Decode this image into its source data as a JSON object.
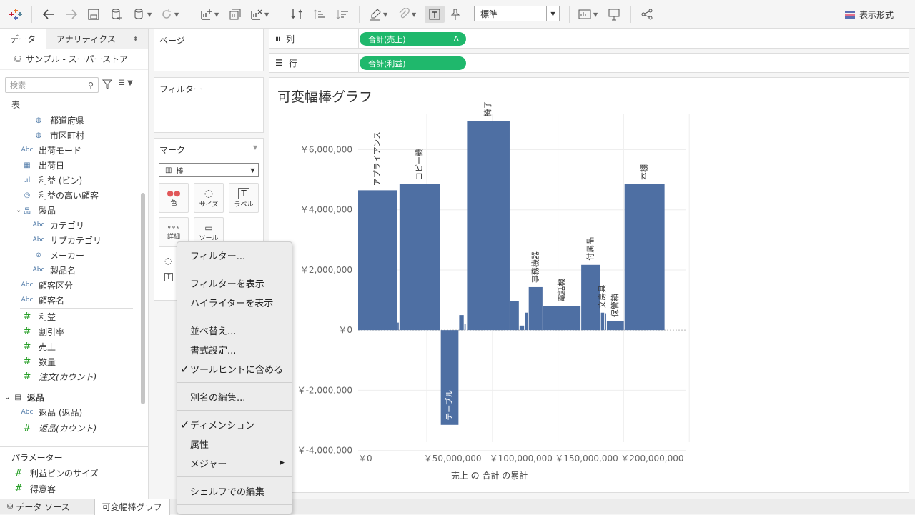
{
  "toolbar": {
    "format_select": "標準",
    "show_me": "表示形式"
  },
  "left_pane": {
    "tab_data": "データ",
    "tab_analytics": "アナリティクス",
    "datasource": "サンプル - スーパーストア",
    "search_placeholder": "検索",
    "section_table": "表",
    "fields": [
      {
        "label": "都道府県",
        "icon": "globe-icon"
      },
      {
        "label": "市区町村",
        "icon": "globe-icon"
      },
      {
        "label": "出荷モード",
        "icon": "abc-icon"
      },
      {
        "label": "出荷日",
        "icon": "calendar-icon"
      },
      {
        "label": "利益 (ビン)",
        "icon": "bin-icon"
      },
      {
        "label": "利益の高い顧客",
        "icon": "set-icon"
      },
      {
        "label": "製品",
        "icon": "hierarchy-icon"
      },
      {
        "label": "カテゴリ",
        "icon": "abc-icon"
      },
      {
        "label": "サブカテゴリ",
        "icon": "abc-icon"
      },
      {
        "label": "メーカー",
        "icon": "paperclip-icon"
      },
      {
        "label": "製品名",
        "icon": "abc-icon"
      },
      {
        "label": "顧客区分",
        "icon": "abc-icon"
      },
      {
        "label": "顧客名",
        "icon": "abc-icon"
      },
      {
        "label": "利益",
        "icon": "hash-icon"
      },
      {
        "label": "割引率",
        "icon": "hash-icon"
      },
      {
        "label": "売上",
        "icon": "hash-icon"
      },
      {
        "label": "数量",
        "icon": "hash-icon"
      },
      {
        "label": "注文(カウント)",
        "icon": "hash-icon"
      }
    ],
    "section_returns": "返品",
    "returns_fields": [
      {
        "label": "返品 (返品)",
        "icon": "abc-icon"
      },
      {
        "label": "返品(カウント)",
        "icon": "hash-icon"
      }
    ],
    "section_params": "パラメーター",
    "params": [
      {
        "label": "利益ビンのサイズ",
        "icon": "hash-icon"
      },
      {
        "label": "得意客",
        "icon": "hash-icon"
      }
    ]
  },
  "cards": {
    "pages": "ページ",
    "filters": "フィルター",
    "marks": "マーク",
    "mark_type": "棒",
    "mark_buttons": [
      "色",
      "サイズ",
      "ラベル",
      "詳細",
      "ツール"
    ]
  },
  "shelves": {
    "columns_label": "列",
    "rows_label": "行",
    "columns_pill": "合計(売上)",
    "columns_pill_delta": "Δ",
    "rows_pill": "合計(利益)"
  },
  "sheet_title": "可変幅棒グラフ",
  "chart_data": {
    "type": "bar",
    "title": "可変幅棒グラフ",
    "xlabel": "売上 の 合計 の累計",
    "ylabel": "",
    "xlim": [
      0,
      250000000
    ],
    "ylim": [
      -4200000,
      7200000
    ],
    "x_ticks": [
      "￥0",
      "￥50,000,000",
      "￥100,000,000",
      "￥150,000,000",
      "￥200,000,000"
    ],
    "y_ticks": [
      "￥6,000,000",
      "￥4,000,000",
      "￥2,000,000",
      "￥0",
      "￥-2,000,000",
      "￥-4,000,000"
    ],
    "bars": [
      {
        "label": "アプライアンス",
        "start": 0,
        "end": 30000000,
        "value": 4650000
      },
      {
        "label": "",
        "start": 30000000,
        "end": 31500000,
        "value": 250000
      },
      {
        "label": "コピー機",
        "start": 31500000,
        "end": 63000000,
        "value": 4850000
      },
      {
        "label": "テーブル",
        "start": 63000000,
        "end": 77000000,
        "value": -3150000
      },
      {
        "label": "",
        "start": 77000000,
        "end": 81000000,
        "value": 500000
      },
      {
        "label": "",
        "start": 81000000,
        "end": 82500000,
        "value": 200000
      },
      {
        "label": "椅子",
        "start": 83000000,
        "end": 116000000,
        "value": 6950000
      },
      {
        "label": "",
        "start": 116000000,
        "end": 123000000,
        "value": 970000
      },
      {
        "label": "",
        "start": 123000000,
        "end": 127000000,
        "value": 150000
      },
      {
        "label": "",
        "start": 127000000,
        "end": 130000000,
        "value": 580000
      },
      {
        "label": "事務機器",
        "start": 130000000,
        "end": 141000000,
        "value": 1430000
      },
      {
        "label": "電話機",
        "start": 141000000,
        "end": 170000000,
        "value": 800000
      },
      {
        "label": "付属品",
        "start": 170000000,
        "end": 185000000,
        "value": 2170000
      },
      {
        "label": "文房具",
        "start": 185000000,
        "end": 188000000,
        "value": 580000
      },
      {
        "label": "",
        "start": 188000000,
        "end": 189500000,
        "value": 560000
      },
      {
        "label": "保管箱",
        "start": 189500000,
        "end": 203000000,
        "value": 290000
      },
      {
        "label": "本棚",
        "start": 203000000,
        "end": 234000000,
        "value": 4850000
      }
    ],
    "color": "#4e6fa3"
  },
  "context_menu": {
    "items": [
      {
        "label": "フィルター...",
        "checked": false
      },
      {
        "label": "フィルターを表示",
        "checked": false
      },
      {
        "label": "ハイライターを表示",
        "checked": false
      },
      {
        "label": "並べ替え...",
        "checked": false
      },
      {
        "label": "書式設定...",
        "checked": false
      },
      {
        "label": "ツールヒントに含める",
        "checked": true
      },
      {
        "label": "別名の編集...",
        "checked": false
      },
      {
        "label": "ディメンション",
        "checked": true
      },
      {
        "label": "属性",
        "checked": false
      },
      {
        "label": "メジャー",
        "checked": false
      },
      {
        "label": "シェルフでの編集",
        "checked": false
      }
    ]
  },
  "bottom_tabs": {
    "datasource": "データ ソース",
    "sheet": "可変幅棒グラフ"
  }
}
